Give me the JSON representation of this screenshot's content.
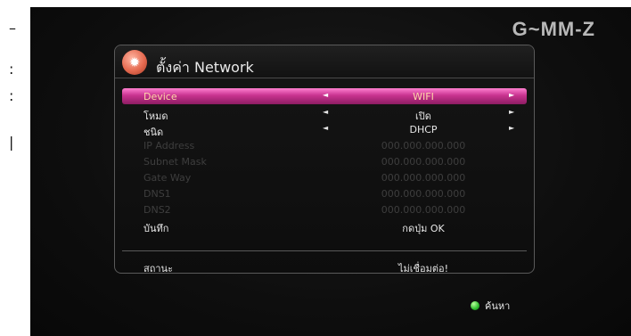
{
  "edge_fragments": [
    "–",
    ":",
    ":",
    "|"
  ],
  "brand": {
    "logo_text": "G~MM-Z"
  },
  "panel": {
    "icon": "network-gear-icon",
    "title": "ตั้งค่า Network"
  },
  "rows": [
    {
      "label": "Device",
      "value": "WIFI",
      "has_arrows": true,
      "state": "selected"
    },
    {
      "label": "โหมด",
      "value": "เปิด",
      "has_arrows": true,
      "state": "normal"
    },
    {
      "label": "ชนิด",
      "value": "DHCP",
      "has_arrows": true,
      "state": "normal"
    },
    {
      "label": "IP Address",
      "value": "000.000.000.000",
      "has_arrows": false,
      "state": "disabled"
    },
    {
      "label": "Subnet Mask",
      "value": "000.000.000.000",
      "has_arrows": false,
      "state": "disabled"
    },
    {
      "label": "Gate Way",
      "value": "000.000.000.000",
      "has_arrows": false,
      "state": "disabled"
    },
    {
      "label": "DNS1",
      "value": "000.000.000.000",
      "has_arrows": false,
      "state": "disabled"
    },
    {
      "label": "DNS2",
      "value": "000.000.000.000",
      "has_arrows": false,
      "state": "disabled"
    },
    {
      "label": "บันทึก",
      "value": "กดปุ่ม OK",
      "has_arrows": false,
      "state": "normal"
    }
  ],
  "status": {
    "label": "สถานะ",
    "value": "ไม่เชื่อมต่อ!"
  },
  "footer": {
    "hint_label": "ค้นหา",
    "hint_icon": "green-button-icon"
  },
  "arrows": {
    "left": "◄",
    "right": "►"
  },
  "colors": {
    "selected_row": "#c8338f",
    "selected_text": "#ffd6a8",
    "disabled_text": "#3e3e3e",
    "normal_text": "#e6e6e6",
    "background": "#0e0e0e"
  }
}
